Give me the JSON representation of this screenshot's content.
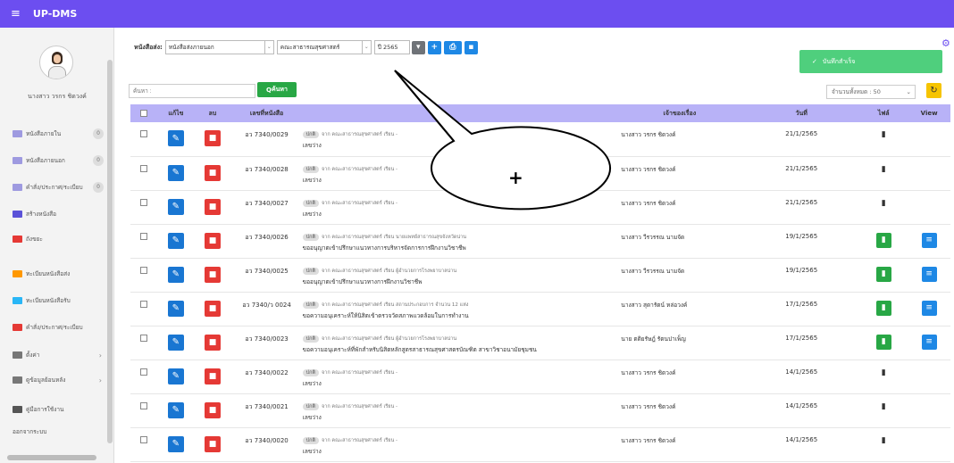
{
  "app": {
    "title": "UP-DMS",
    "menu_icon": "hamburger-icon"
  },
  "sidebar": {
    "username": "นางสาว วรกร ชิดวงค์",
    "items": [
      {
        "label": "หนังสือภายใน",
        "badge": "0",
        "icon_color": "#9e9ae0"
      },
      {
        "label": "หนังสือภายนอก",
        "badge": "0",
        "icon_color": "#9e9ae0"
      },
      {
        "label": "คำสั่ง/ประกาศ/ระเบียบ",
        "badge": "0",
        "icon_color": "#9e9ae0"
      },
      {
        "label": "สร้างหนังสือ",
        "icon_color": "#5b52d8"
      },
      {
        "label": "ถังขยะ",
        "icon_color": "#e53935"
      },
      {
        "label": "ทะเบียนหนังสือส่ง",
        "icon_color": "#ff9800"
      },
      {
        "label": "ทะเบียนหนังสือรับ",
        "icon_color": "#29b6f6"
      },
      {
        "label": "คำสั่ง/ประกาศ/ระเบียบ",
        "icon_color": "#e53935"
      },
      {
        "label": "ตั้งค่า",
        "icon_color": "#777777"
      },
      {
        "label": "ดูข้อมูลย้อนหลัง",
        "icon_color": "#777777"
      },
      {
        "label": "คู่มือการใช้งาน",
        "icon_color": "#555555"
      },
      {
        "label": "ออกจากระบบ"
      }
    ]
  },
  "filter": {
    "label": "หนังสือส่ง:",
    "type_value": "หนังสือส่งภายนอก",
    "dept_value": "คณะสาธารณสุขศาสตร์",
    "year_value": "ปี 2565"
  },
  "toast": {
    "text": "บันทึกสำเร็จ"
  },
  "search": {
    "placeholder": "ค้นหา :",
    "button": "ค้นหา"
  },
  "total": {
    "text": "จำนวนทั้งหมด : 50"
  },
  "table": {
    "headers": {
      "edit": "แก้ไข",
      "delete": "ลบ",
      "docnum": "เลขที่หนังสือ",
      "owner": "เจ้าของเรื่อง",
      "date": "วันที่",
      "file": "ไฟล์",
      "view": "View"
    },
    "rows": [
      {
        "docnum": "อว 7340/0029",
        "chip": "ปกติ",
        "from": "จาก คณะสาธารณสุขศาสตร์ เรียน -",
        "line2": "เลขว่าง",
        "owner": "นางสาว วรกร ชิดวงค์",
        "date": "21/1/2565",
        "file": "gray",
        "view": false
      },
      {
        "docnum": "อว 7340/0028",
        "chip": "ปกติ",
        "from": "จาก คณะสาธารณสุขศาสตร์ เรียน -",
        "line2": "เลขว่าง",
        "owner": "นางสาว วรกร ชิดวงค์",
        "date": "21/1/2565",
        "file": "gray",
        "view": false
      },
      {
        "docnum": "อว 7340/0027",
        "chip": "ปกติ",
        "from": "จาก คณะสาธารณสุขศาสตร์ เรียน -",
        "line2": "เลขว่าง",
        "owner": "นางสาว วรกร ชิดวงค์",
        "date": "21/1/2565",
        "file": "gray",
        "view": false
      },
      {
        "docnum": "อว 7340/0026",
        "chip": "ปกติ",
        "from": "จาก คณะสาธารณสุขศาสตร์ เรียน นายแพทย์สาธารณสุขจังหวัดน่าน",
        "line2": "ขออนุญาตเข้าปรึกษาแนวทางการบริหารจัดการการฝึกงานวิชาชีพ",
        "owner": "นางสาว วีรวรรณ นามจัด",
        "date": "19/1/2565",
        "file": "green",
        "view": true
      },
      {
        "docnum": "อว 7340/0025",
        "chip": "ปกติ",
        "from": "จาก คณะสาธารณสุขศาสตร์ เรียน ผู้อำนวยการโรงพยาบาลน่าน",
        "line2": "ขออนุญาตเข้าปรึกษาแนวทางการฝึกงานวิชาชีพ",
        "owner": "นางสาว วีรวรรณ นามจัด",
        "date": "19/1/2565",
        "file": "green",
        "view": true
      },
      {
        "docnum": "อว 7340/ว 0024",
        "chip": "ปกติ",
        "from": "จาก คณะสาธารณสุขศาสตร์ เรียน สถานประกอบการ จำนวน 12 แห่ง",
        "line2": "ขอความอนุเคราะห์ให้นิสิตเข้าตรวจวัดสภาพแวดล้อมในการทำงาน",
        "owner": "นางสาว สุดารัตน์ หล่อวงค์",
        "date": "17/1/2565",
        "file": "green",
        "view": true
      },
      {
        "docnum": "อว 7340/0023",
        "chip": "ปกติ",
        "from": "จาก คณะสาธารณสุขศาสตร์ เรียน ผู้อำนวยการโรงพยาบาลน่าน",
        "line2": "ขอความอนุเคราะห์ที่พักสำหรับนิสิตหลักสูตรสาธารณสุขศาสตรบัณฑิต สาขาวิชาอนามัยชุมชน",
        "owner": "นาย ตติยรัษฎ์ รัตนปาเพ็ญ",
        "date": "17/1/2565",
        "file": "green",
        "view": true
      },
      {
        "docnum": "อว 7340/0022",
        "chip": "ปกติ",
        "from": "จาก คณะสาธารณสุขศาสตร์ เรียน -",
        "line2": "เลขว่าง",
        "owner": "นางสาว วรกร ชิดวงค์",
        "date": "14/1/2565",
        "file": "gray",
        "view": false
      },
      {
        "docnum": "อว 7340/0021",
        "chip": "ปกติ",
        "from": "จาก คณะสาธารณสุขศาสตร์ เรียน -",
        "line2": "เลขว่าง",
        "owner": "นางสาว วรกร ชิดวงค์",
        "date": "14/1/2565",
        "file": "gray",
        "view": false
      },
      {
        "docnum": "อว 7340/0020",
        "chip": "ปกติ",
        "from": "จาก คณะสาธารณสุขศาสตร์ เรียน -",
        "line2": "เลขว่าง",
        "owner": "นางสาว วรกร ชิดวงค์",
        "date": "14/1/2565",
        "file": "gray",
        "view": false
      }
    ]
  },
  "callout": {
    "text": "+"
  }
}
